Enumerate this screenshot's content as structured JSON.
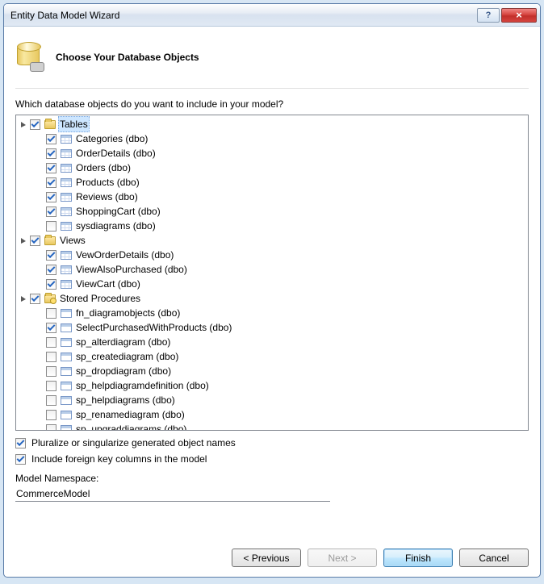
{
  "window": {
    "title": "Entity Data Model Wizard"
  },
  "header": {
    "title": "Choose Your Database Objects"
  },
  "prompt": "Which database objects do you want to include in your model?",
  "groups": [
    {
      "key": "tables",
      "label": "Tables",
      "checked": true,
      "selected": true,
      "icon": "folder",
      "items": [
        {
          "label": "Categories (dbo)",
          "checked": true
        },
        {
          "label": "OrderDetails (dbo)",
          "checked": true
        },
        {
          "label": "Orders (dbo)",
          "checked": true
        },
        {
          "label": "Products (dbo)",
          "checked": true
        },
        {
          "label": "Reviews (dbo)",
          "checked": true
        },
        {
          "label": "ShoppingCart (dbo)",
          "checked": true
        },
        {
          "label": "sysdiagrams (dbo)",
          "checked": false
        }
      ]
    },
    {
      "key": "views",
      "label": "Views",
      "checked": true,
      "icon": "folder",
      "items": [
        {
          "label": "VewOrderDetails (dbo)",
          "checked": true
        },
        {
          "label": "ViewAlsoPurchased (dbo)",
          "checked": true
        },
        {
          "label": "ViewCart (dbo)",
          "checked": true
        }
      ]
    },
    {
      "key": "procs",
      "label": "Stored Procedures",
      "checked": true,
      "icon": "folder-proc",
      "items": [
        {
          "label": "fn_diagramobjects (dbo)",
          "checked": false,
          "proc": true
        },
        {
          "label": "SelectPurchasedWithProducts (dbo)",
          "checked": true,
          "proc": true
        },
        {
          "label": "sp_alterdiagram (dbo)",
          "checked": false,
          "proc": true
        },
        {
          "label": "sp_creatediagram (dbo)",
          "checked": false,
          "proc": true
        },
        {
          "label": "sp_dropdiagram (dbo)",
          "checked": false,
          "proc": true
        },
        {
          "label": "sp_helpdiagramdefinition (dbo)",
          "checked": false,
          "proc": true
        },
        {
          "label": "sp_helpdiagrams (dbo)",
          "checked": false,
          "proc": true
        },
        {
          "label": "sp_renamediagram (dbo)",
          "checked": false,
          "proc": true
        },
        {
          "label": "sp_upgraddiagrams (dbo)",
          "checked": false,
          "proc": true
        }
      ]
    }
  ],
  "options": {
    "pluralize": {
      "label": "Pluralize or singularize generated object names",
      "checked": true
    },
    "foreignKeys": {
      "label": "Include foreign key columns in the model",
      "checked": true
    }
  },
  "namespace": {
    "label": "Model Namespace:",
    "value": "CommerceModel"
  },
  "buttons": {
    "previous": "< Previous",
    "next": "Next >",
    "finish": "Finish",
    "cancel": "Cancel"
  }
}
